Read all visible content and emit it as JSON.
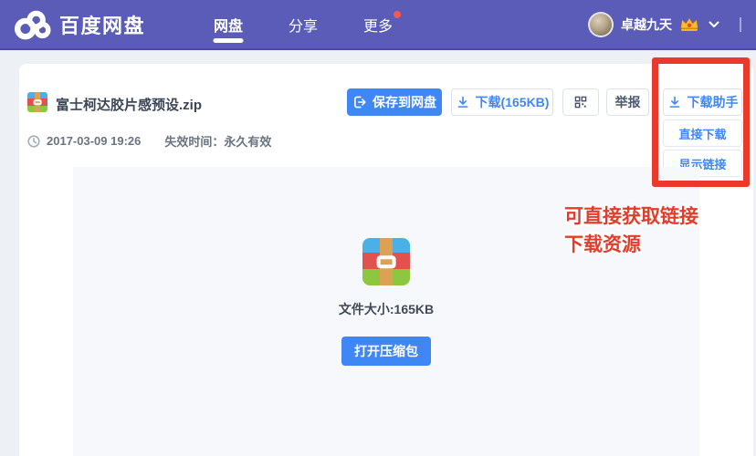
{
  "header": {
    "brand": "百度网盘",
    "nav": [
      {
        "label": "网盘"
      },
      {
        "label": "分享"
      },
      {
        "label": "更多"
      }
    ],
    "user": {
      "name": "卓越九天"
    }
  },
  "file": {
    "name": "富士柯达胶片感预设",
    "ext": ".zip",
    "time": "2017-03-09 19:26",
    "expire": "失效时间：永久有效"
  },
  "toolbar": {
    "save": "保存到网盘",
    "download": "下载(165KB)",
    "report": "举报"
  },
  "helper": {
    "button": "下载助手",
    "items": [
      "直接下载",
      "显示链接"
    ]
  },
  "preview": {
    "size": "文件大小:165KB",
    "open": "打开压缩包"
  },
  "annotation": {
    "line1": "可直接获取链接",
    "line2": "下载资源"
  },
  "icons": {
    "logo": "baidu-cloud-icon",
    "save": "export-icon",
    "download": "download-arrow-icon",
    "qr": "qr-code-icon",
    "report_none": "",
    "clock": "clock-icon",
    "crown": "vip-crown-icon",
    "chevron": "chevron-down-icon",
    "zip": "winrar-zip-icon"
  },
  "colors": {
    "header_bg": "#5a5cb8",
    "accent_blue": "#3f87f5",
    "annotation_red": "#e8392a",
    "badge_red": "#f05b4c",
    "panel_bg": "#ffffff",
    "preview_bg": "#f6f8fb"
  }
}
